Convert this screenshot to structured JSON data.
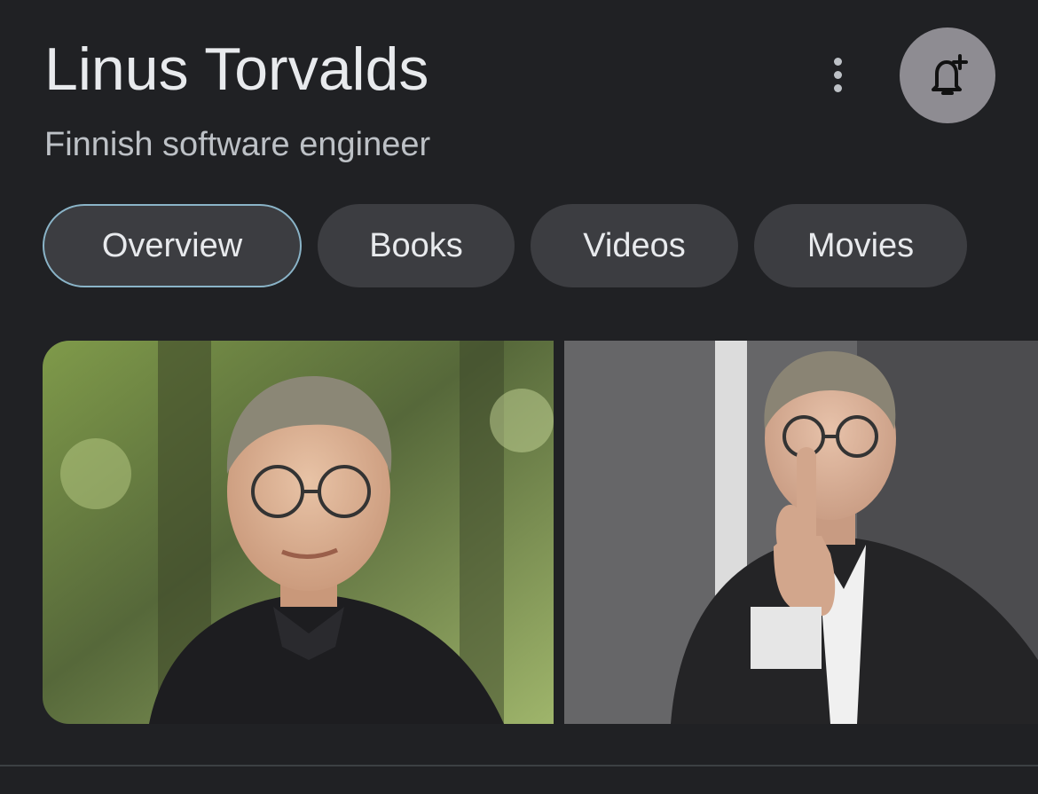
{
  "entity": {
    "title": "Linus Torvalds",
    "subtitle": "Finnish software engineer"
  },
  "actions": {
    "more_icon": "more-vertical-icon",
    "notify_icon": "bell-plus-icon"
  },
  "tabs": [
    {
      "label": "Overview",
      "active": true
    },
    {
      "label": "Books",
      "active": false
    },
    {
      "label": "Videos",
      "active": false
    },
    {
      "label": "Movies",
      "active": false
    }
  ],
  "images": [
    {
      "subject": "portrait-photo"
    },
    {
      "subject": "photo-middle-finger-gesture"
    }
  ],
  "colors": {
    "background": "#202124",
    "chip_background": "#3c3d41",
    "chip_active_border": "#8ab4c8",
    "bell_button": "#8e8c92",
    "text_primary": "#e8eaed",
    "text_secondary": "#bdc1c6"
  }
}
